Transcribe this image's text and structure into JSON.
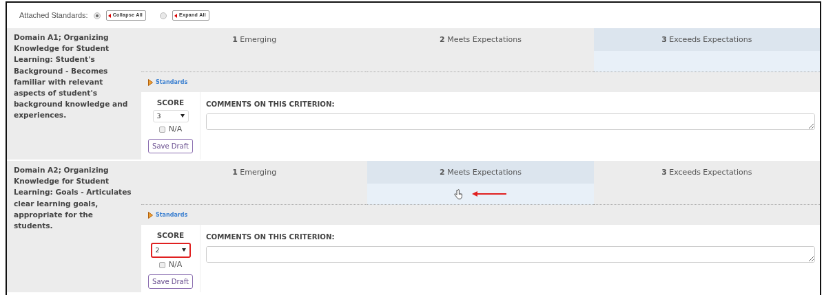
{
  "toolbar": {
    "label": "Attached Standards:",
    "options": [
      {
        "label": "Collapse All",
        "selected": true
      },
      {
        "label": "Expand All",
        "selected": false
      }
    ]
  },
  "criteria": [
    {
      "title": "Domain A1; Organizing Knowledge for Student Learning: Student's Background - Becomes familiar with relevant aspects of student's background knowledge and experiences.",
      "levels": [
        {
          "number": "1",
          "label": "Emerging",
          "selected": false
        },
        {
          "number": "2",
          "label": "Meets Expectations",
          "selected": false
        },
        {
          "number": "3",
          "label": "Exceeds Expectations",
          "selected": true
        }
      ],
      "pointer": false,
      "standards_link": "Standards",
      "score_label": "SCORE",
      "score": "3",
      "score_highlighted": false,
      "na_label": "N/A",
      "na_checked": false,
      "save_button": "Save Draft",
      "comments_label": "COMMENTS ON THIS CRITERION:"
    },
    {
      "title": "Domain A2; Organizing Knowledge for Student Learning: Goals - Articulates clear learning goals, appropriate for the students.",
      "levels": [
        {
          "number": "1",
          "label": "Emerging",
          "selected": false
        },
        {
          "number": "2",
          "label": "Meets Expectations",
          "selected": true
        },
        {
          "number": "3",
          "label": "Exceeds Expectations",
          "selected": false
        }
      ],
      "pointer": true,
      "standards_link": "Standards",
      "score_label": "SCORE",
      "score": "2",
      "score_highlighted": true,
      "na_label": "N/A",
      "na_checked": false,
      "save_button": "Save Draft",
      "comments_label": "COMMENTS ON THIS CRITERION:"
    }
  ]
}
